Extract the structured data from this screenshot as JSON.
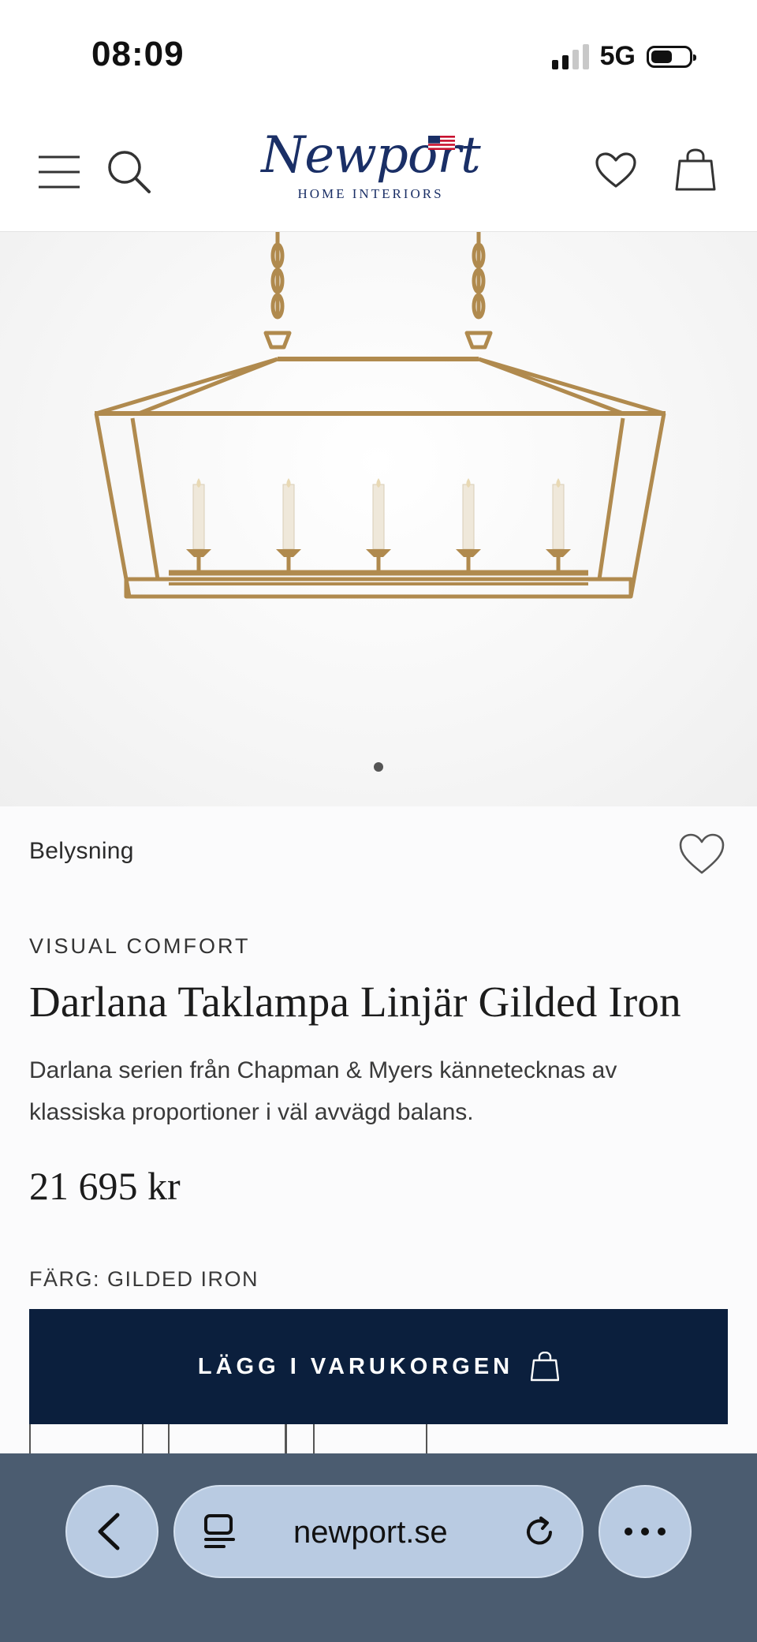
{
  "status_bar": {
    "time": "08:09",
    "network": "5G"
  },
  "header": {
    "logo_script": "Newport",
    "logo_subtitle": "HOME INTERIORS",
    "icons": [
      "menu-icon",
      "search-icon",
      "heart-icon",
      "bag-icon"
    ]
  },
  "gallery": {
    "image_count": 1,
    "active_index": 0
  },
  "product": {
    "category": "Belysning",
    "brand": "VISUAL COMFORT",
    "title": "Darlana Taklampa Linjär Gilded Iron",
    "description": "Darlana serien från Chapman & Myers kännetecknas av klassiska proportioner i väl avvägd balans.",
    "price": "21 695 kr",
    "color_label": "FÄRG: GILDED IRON",
    "add_to_cart_label": "LÄGG I VARUKORGEN"
  },
  "browser": {
    "url": "newport.se"
  },
  "colors": {
    "primary_navy": "#0b1f3d",
    "logo_blue": "#1a2f66",
    "browser_bar": "#4b5c70"
  }
}
